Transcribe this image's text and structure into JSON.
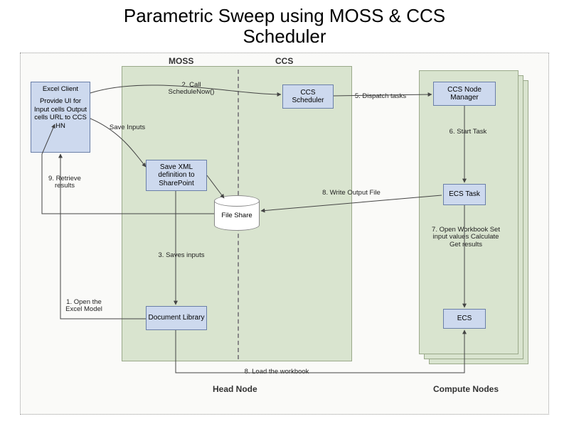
{
  "title_line1": "Parametric Sweep using MOSS & CCS",
  "title_line2": "Scheduler",
  "regions": {
    "moss": "MOSS",
    "ccs": "CCS"
  },
  "footer": {
    "head": "Head Node",
    "compute": "Compute Nodes"
  },
  "excel": {
    "name": "Excel Client",
    "desc": "Provide UI for Input cells Output cells URL to CCS HN"
  },
  "nodes": {
    "save_xml": "Save XML definition to SharePoint",
    "doc_lib": "Document Library",
    "ccs_sched": "CCS Scheduler",
    "node_mgr": "CCS Node Manager",
    "ecs_task": "ECS Task",
    "ecs": "ECS"
  },
  "cylinder": "File Share",
  "labels": {
    "l1": "1. Open the Excel Model",
    "l2": "2. Call ScheduleNow()",
    "l3": "3. Saves inputs",
    "save_inputs": "Save Inputs",
    "l5": "5. Dispatch tasks",
    "l6": "6. Start Task",
    "l7": "7. Open Workbook Set input values Calculate Get results",
    "l8w": "8. Write Output File",
    "l8l": "8. Load the workbook",
    "l9": "9. Retrieve results"
  }
}
